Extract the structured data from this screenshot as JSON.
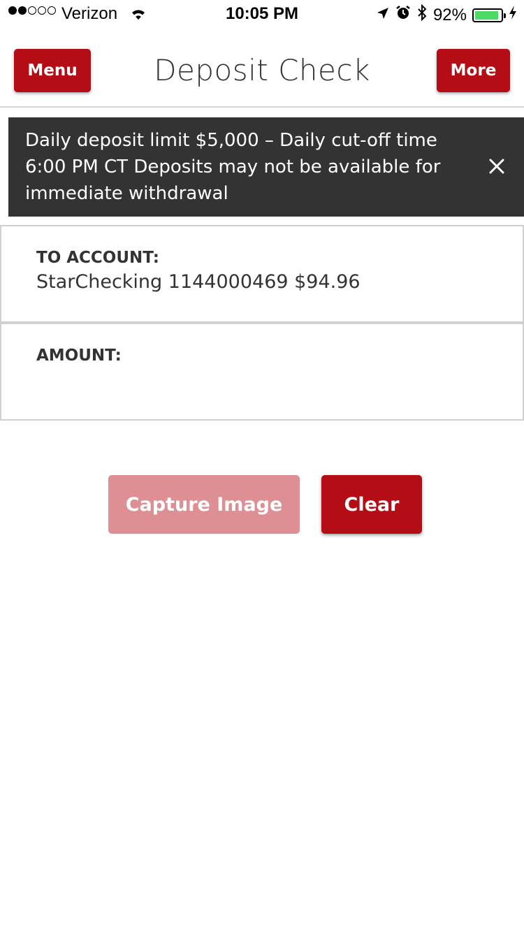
{
  "status_bar": {
    "carrier": "Verizon",
    "time": "10:05 PM",
    "battery_percent": "92%",
    "battery_level": 0.92,
    "signal_bars_filled": 2,
    "signal_bars_total": 5
  },
  "header": {
    "title": "Deposit Check",
    "menu_label": "Menu",
    "more_label": "More"
  },
  "banner": {
    "message": "Daily deposit limit $5,000 – Daily cut-off time 6:00 PM CT Deposits may not be available for immediate withdrawal"
  },
  "form": {
    "to_account_label": "TO ACCOUNT:",
    "to_account_value": "StarChecking 1144000469 $94.96",
    "amount_label": "AMOUNT:",
    "amount_value": ""
  },
  "actions": {
    "capture_label": "Capture Image",
    "clear_label": "Clear"
  },
  "colors": {
    "brand_red": "#b50d15",
    "disabled_red": "#de8f93",
    "banner_bg": "#333333",
    "battery_green": "#4cd964"
  },
  "icons": {
    "wifi": "wifi-icon",
    "location": "location-arrow-icon",
    "alarm": "alarm-clock-icon",
    "bluetooth": "bluetooth-icon",
    "charging": "charging-bolt-icon",
    "close": "close-icon"
  }
}
